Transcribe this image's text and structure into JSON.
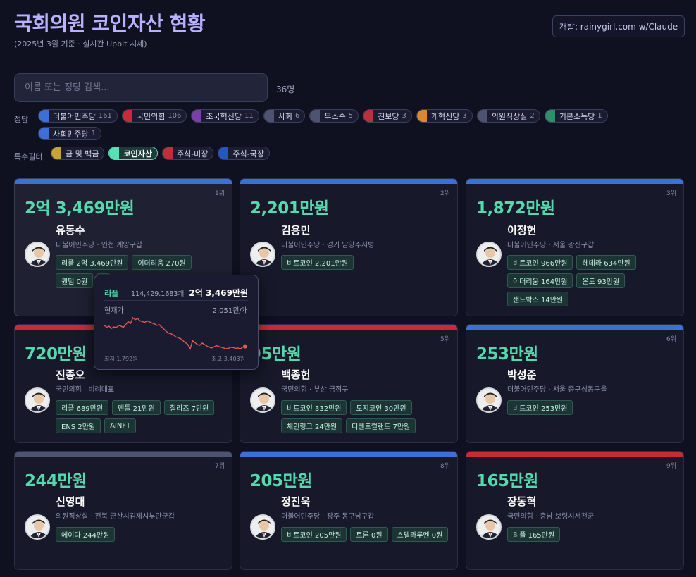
{
  "header": {
    "title": "국회의원 코인자산 현황",
    "subtitle": "(2025년 3월 기준 · 실시간 Upbit 시세)",
    "credit": "개발: rainygirl.com w/Claude"
  },
  "search": {
    "placeholder": "이름 또는 정당 검색...",
    "value": "",
    "count": "36명"
  },
  "party_filter": {
    "label": "정당",
    "items": [
      {
        "label": "더불어민주당",
        "count": "161",
        "color": "#3d6fd6"
      },
      {
        "label": "국민의힘",
        "count": "106",
        "color": "#c92a37"
      },
      {
        "label": "조국혁신당",
        "count": "11",
        "color": "#7a3fa8"
      },
      {
        "label": "사회",
        "count": "6",
        "color": "#4d5370"
      },
      {
        "label": "무소속",
        "count": "5",
        "color": "#4d5370"
      },
      {
        "label": "진보당",
        "count": "3",
        "color": "#b8323e"
      },
      {
        "label": "개혁신당",
        "count": "3",
        "color": "#d98a2b"
      },
      {
        "label": "의원직상실",
        "count": "2",
        "color": "#4d5370"
      },
      {
        "label": "기본소득당",
        "count": "1",
        "color": "#2f8f6a"
      },
      {
        "label": "사회민주당",
        "count": "1",
        "color": "#3d6fd6"
      }
    ]
  },
  "special_filter": {
    "label": "특수필터",
    "items": [
      {
        "label": "금 및 백금",
        "color": "#c7a234",
        "active": false
      },
      {
        "label": "코인자산",
        "color": "#55e3b4",
        "active": true
      },
      {
        "label": "주식-미장",
        "color": "#c92a37",
        "active": false
      },
      {
        "label": "주식-국장",
        "color": "#2556c4",
        "active": false
      }
    ]
  },
  "cards": [
    {
      "rank": "1위",
      "total": "2억 3,469만원",
      "name": "유동수",
      "meta": "더불어민주당 · 인천 계양구갑",
      "bar": "#3d6fd6",
      "tags": [
        "리플 2억 3,469만원",
        "이더리움 270원",
        "퀀텀 0원",
        "."
      ]
    },
    {
      "rank": "2위",
      "total": "2,201만원",
      "name": "김용민",
      "meta": "더불어민주당 · 경기 남양주시병",
      "bar": "#3d6fd6",
      "tags": [
        "비트코인 2,201만원"
      ]
    },
    {
      "rank": "3위",
      "total": "1,872만원",
      "name": "이정헌",
      "meta": "더불어민주당 · 서울 광진구갑",
      "bar": "#3d6fd6",
      "tags": [
        "비트코인 966만원",
        "헤데라 634만원",
        "이더리움 164만원",
        "온도 93만원",
        "샌드박스 14만원"
      ]
    },
    {
      "rank": "",
      "total": "720만원",
      "name": "진종오",
      "meta": "국민의힘 · 비례대표",
      "bar": "#c92a37",
      "tags": [
        "리플 689만원",
        "맨틀 21만원",
        "칠리즈 7만원",
        "ENS 2만원",
        "AINFT"
      ]
    },
    {
      "rank": "5위",
      "total": "95만원",
      "name": "백종헌",
      "meta": "국민의힘 · 부산 금정구",
      "bar": "#c92a37",
      "tags": [
        "비트코인 332만원",
        "도지코인 30만원",
        "체인링크 24만원",
        "디센트럴랜드 7만원"
      ]
    },
    {
      "rank": "6위",
      "total": "253만원",
      "name": "박성준",
      "meta": "더불어민주당 · 서울 중구성동구을",
      "bar": "#3d6fd6",
      "tags": [
        "비트코인 253만원"
      ]
    },
    {
      "rank": "7위",
      "total": "244만원",
      "name": "신영대",
      "meta": "의원직상실 · 전북 군산시김제시부안군갑",
      "bar": "#4d5370",
      "tags": [
        "에이다 244만원"
      ]
    },
    {
      "rank": "8위",
      "total": "205만원",
      "name": "정진욱",
      "meta": "더불어민주당 · 광주 동구남구갑",
      "bar": "#3d6fd6",
      "tags": [
        "비트코인 205만원",
        "트론 0원",
        "스텔라루멘 0원"
      ]
    },
    {
      "rank": "9위",
      "total": "165만원",
      "name": "장동혁",
      "meta": "국민의힘 · 충남 보령시서천군",
      "bar": "#c92a37",
      "tags": [
        "리플 165만원"
      ]
    }
  ],
  "tooltip": {
    "coin": "리플",
    "quantity": "114,429.1683개",
    "value": "2억 3,469만원",
    "price_label": "현재가",
    "price": "2,051원/개",
    "min": "최저 1,792원",
    "max": "최고 3,403원",
    "line_color": "#e05a4f",
    "series": [
      2600,
      2550,
      2580,
      2520,
      2560,
      2540,
      2600,
      2580,
      2550,
      2620,
      2700,
      2650,
      2800,
      2750,
      2780,
      2720,
      2700,
      2680,
      2720,
      2690,
      2660,
      2640,
      2600,
      2620,
      2560,
      2500,
      2440,
      2400,
      2380,
      2350,
      2300,
      2280,
      2250,
      2200,
      2150,
      2100,
      1990,
      2200,
      2150,
      2100,
      2080,
      2140,
      2100,
      2060,
      2030,
      2010,
      2040,
      2070,
      2050,
      2030,
      2010,
      1990,
      2000,
      2030,
      2020,
      2000,
      2010,
      1990,
      2030,
      2051
    ]
  }
}
